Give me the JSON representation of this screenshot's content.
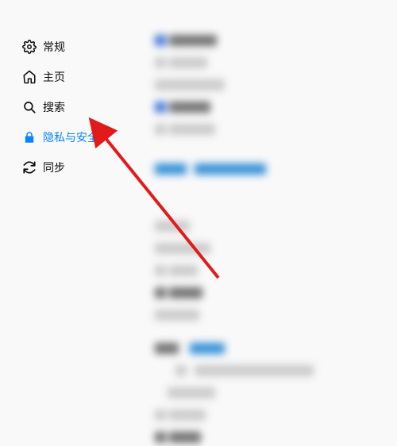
{
  "sidebar": {
    "items": [
      {
        "label": "常规"
      },
      {
        "label": "主页"
      },
      {
        "label": "搜索"
      },
      {
        "label": "隐私与安全"
      },
      {
        "label": "同步"
      }
    ]
  },
  "annotation": {
    "arrow_color": "#e11b1b",
    "points_to": "隐私与安全"
  }
}
